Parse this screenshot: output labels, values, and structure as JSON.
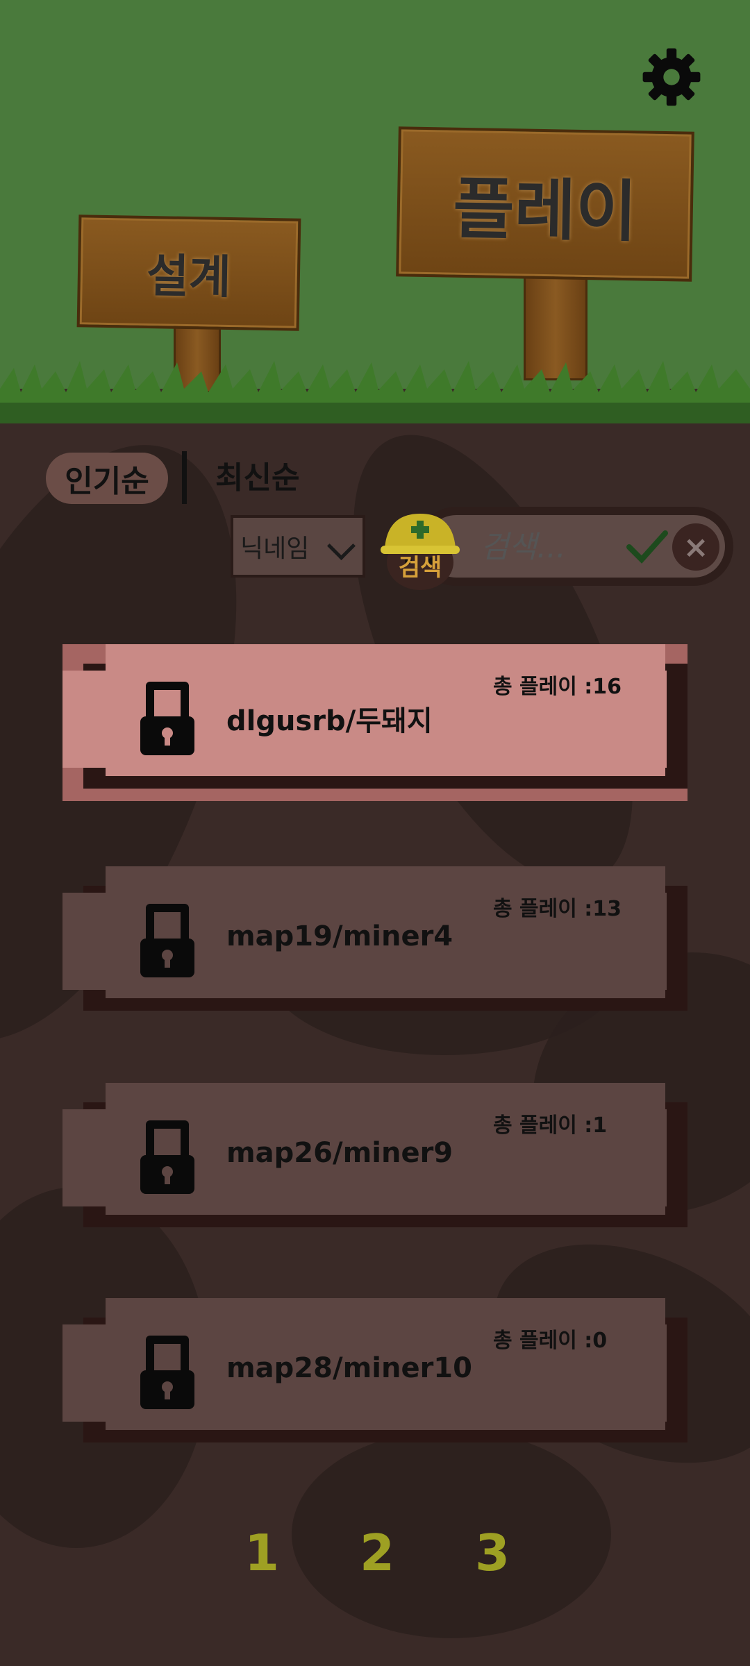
{
  "signs": {
    "design": "설계",
    "play": "플레이"
  },
  "sort": {
    "popular": "인기순",
    "latest": "최신순"
  },
  "search": {
    "filter_label": "닉네임",
    "placeholder": "검색...",
    "mole_label": "검색"
  },
  "maps": [
    {
      "title": "dlgusrb/두돼지",
      "plays": "총 플레이 :16",
      "selected": true
    },
    {
      "title": "map19/miner4",
      "plays": "총 플레이 :13"
    },
    {
      "title": "map26/miner9",
      "plays": "총 플레이 :1"
    },
    {
      "title": "map28/miner10",
      "plays": "총 플레이 :0"
    }
  ],
  "pagination": {
    "pages": [
      "1",
      "2",
      "3"
    ]
  },
  "colors": {
    "sky": "#4a7a3c",
    "dirt": "#3a2a27",
    "card": "#5c4542",
    "card_selected": "#c98a86",
    "page_number": "#9ea023"
  }
}
